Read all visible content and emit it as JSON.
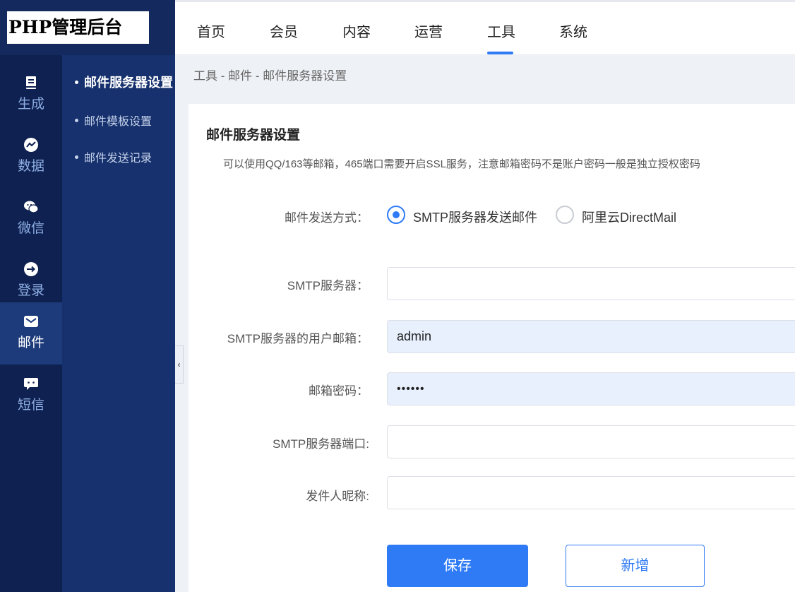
{
  "app": {
    "logo_text": "PHP管理后台"
  },
  "rail": [
    {
      "label": "生成",
      "icon": "document-icon"
    },
    {
      "label": "数据",
      "icon": "chart-icon"
    },
    {
      "label": "微信",
      "icon": "wechat-icon"
    },
    {
      "label": "登录",
      "icon": "login-arrow-icon"
    },
    {
      "label": "邮件",
      "icon": "mail-icon",
      "active": true
    },
    {
      "label": "短信",
      "icon": "sms-icon"
    }
  ],
  "submenu": [
    {
      "label": "邮件服务器设置",
      "active": true
    },
    {
      "label": "邮件模板设置"
    },
    {
      "label": "邮件发送记录"
    }
  ],
  "topnav": [
    "首页",
    "会员",
    "内容",
    "运营",
    "工具",
    "系统"
  ],
  "topnav_active": "工具",
  "breadcrumb": "工具 - 邮件 - 邮件服务器设置",
  "card": {
    "title": "邮件服务器设置",
    "description": "可以使用QQ/163等邮箱，465端口需要开启SSL服务，注意邮箱密码不是账户密码一般是独立授权密码"
  },
  "form": {
    "send_method_label": "邮件发送方式：",
    "send_method_options": [
      "SMTP服务器发送邮件",
      "阿里云DirectMail"
    ],
    "send_method_selected": "SMTP服务器发送邮件",
    "smtp_server_label": "SMTP服务器：",
    "smtp_server_value": "",
    "smtp_user_label": "SMTP服务器的用户邮箱：",
    "smtp_user_value": "admin",
    "password_label": "邮箱密码：",
    "password_value": "••••••",
    "port_label": "SMTP服务器端口:",
    "port_value": "",
    "sender_name_label": "发件人昵称:",
    "sender_name_value": ""
  },
  "buttons": {
    "save": "保存",
    "add": "新增"
  },
  "colors": {
    "accent": "#2f7bf5",
    "rail_bg": "#0f2150",
    "submenu_bg": "#16316d"
  }
}
